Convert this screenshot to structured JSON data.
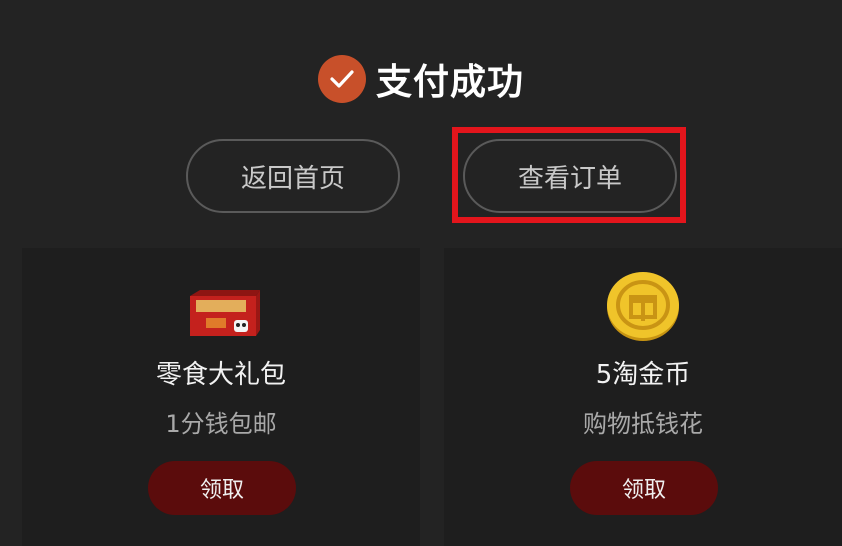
{
  "header": {
    "status_icon": "check-icon",
    "title": "支付成功"
  },
  "actions": {
    "home_label": "返回首页",
    "order_label": "查看订单"
  },
  "rewards": [
    {
      "icon": "gift-box-image",
      "name": "零食大礼包",
      "subtitle": "1分钱包邮",
      "claim_label": "领取"
    },
    {
      "icon": "gold-coin-icon",
      "name": "5淘金币",
      "subtitle": "购物抵钱花",
      "claim_label": "领取"
    }
  ],
  "colors": {
    "background": "#232323",
    "accent": "#c8502a",
    "claim_button": "#5b0c0c",
    "highlight": "#e3151c",
    "coin": "#e8b820"
  }
}
